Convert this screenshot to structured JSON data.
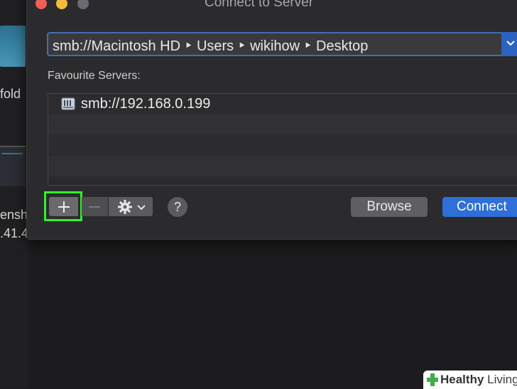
{
  "background": {
    "text_lines": [
      "fold",
      "ensh",
      ".41.4"
    ]
  },
  "window": {
    "title": "Connect to Server",
    "address": {
      "value": "smb://Macintosh HD ‣ Users ‣ wikihow ‣ Desktop",
      "dropdown_icon": "chevron-down-icon"
    },
    "favourites_label": "Favourite Servers:",
    "servers": [
      {
        "label": "smb://192.168.0.199",
        "icon": "server-icon"
      }
    ],
    "toolbar": {
      "add_icon": "plus-icon",
      "remove_icon": "minus-icon",
      "actions_icon": "gear-icon",
      "help_label": "?"
    },
    "buttons": {
      "browse": "Browse",
      "connect": "Connect"
    }
  },
  "watermark": {
    "brand": "Healthy",
    "brand2": "Living"
  },
  "colors": {
    "accent": "#2e6fd8",
    "highlight": "#2ff02b",
    "close": "#ee5f57",
    "minimize": "#f2bb3d"
  }
}
